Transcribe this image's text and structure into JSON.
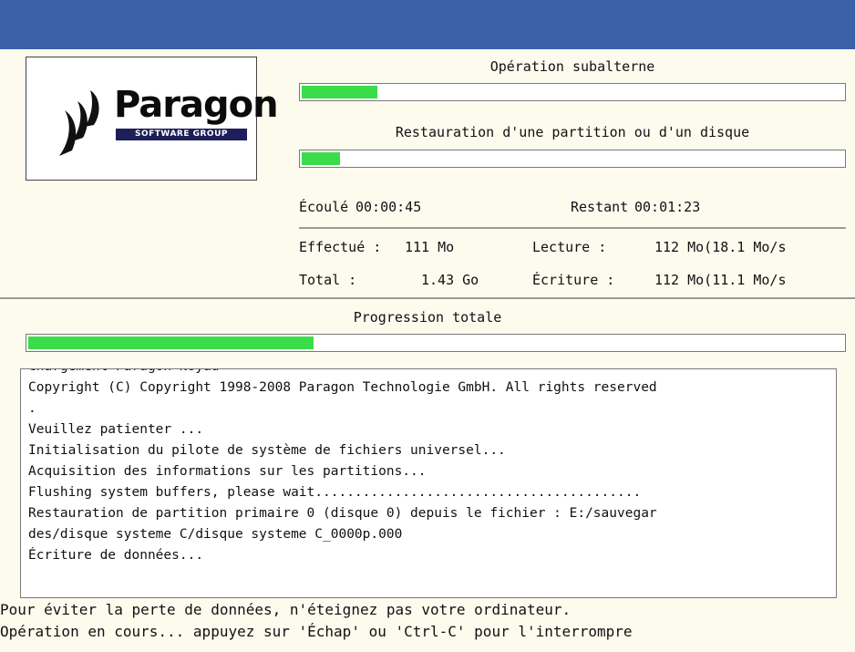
{
  "logo": {
    "brand": "Paragon",
    "subtitle": "SOFTWARE GROUP"
  },
  "progress": {
    "sub_operation": {
      "label": "Opération subalterne",
      "fraction": 0.14
    },
    "restore": {
      "label": "Restauration d'une partition ou d'un disque",
      "fraction": 0.07
    },
    "total": {
      "label": "Progression totale",
      "fraction": 0.35
    }
  },
  "time": {
    "elapsed_label": "Écoulé",
    "elapsed_value": "00:00:45",
    "remaining_label": "Restant",
    "remaining_value": "00:01:23"
  },
  "stats": {
    "done_label": "Effectué :",
    "done_value": "111 Mo",
    "read_label": "Lecture :",
    "read_value": "112 Mo(18.1 Mo/s",
    "total_label": "Total :",
    "total_value": "1.43 Go",
    "write_label": "Écriture :",
    "write_value": "112 Mo(11.1 Mo/s"
  },
  "log": [
    "Chargement Paragon Noyau",
    "Copyright (C) Copyright 1998-2008 Paragon Technologie GmbH. All rights reserved",
    ".",
    "Veuillez patienter ...",
    "Initialisation du pilote de système de fichiers universel...",
    "Acquisition des informations sur les partitions...",
    "Flushing system buffers, please wait.........................................",
    "Restauration de partition primaire 0 (disque 0) depuis le fichier : E:/sauvegar",
    "des/disque systeme C/disque systeme C_0000p.000",
    "Écriture de données..."
  ],
  "footer": {
    "line1": "Pour éviter la perte de données, n'éteignez pas votre ordinateur.",
    "line2": "Opération en cours... appuyez sur 'Échap' ou 'Ctrl-C' pour l'interrompre"
  },
  "colors": {
    "titlebar": "#3a61a8",
    "panel": "#fdfbee",
    "progress_fill": "#3bdc4a"
  }
}
